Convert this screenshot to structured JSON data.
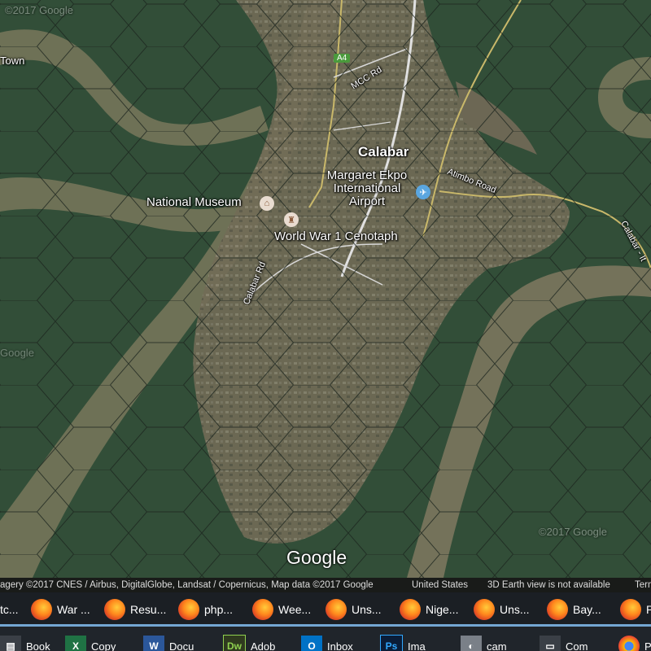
{
  "map": {
    "watermark_top": "©2017 Google",
    "watermark_bottom": "©2017 Google",
    "watermark_left": "Google",
    "labels": {
      "town": "Town",
      "city": "Calabar",
      "airport_line1": "Margaret Ekpo",
      "airport_line2": "International",
      "airport_line3": "Airport",
      "museum": "National Museum",
      "cenotaph": "World War 1 Cenotaph",
      "road_mcc": "MCC Rd",
      "road_a4": "A4",
      "road_atimbo": "Atimbo Road",
      "road_calabar": "Calabar Rd",
      "road_calabar_right": "Calabar - It"
    },
    "logo": "Google"
  },
  "attribution": {
    "imagery": "agery ©2017 CNES / Airbus, DigitalGlobe, Landsat / Copernicus, Map data ©2017 Google",
    "region": "United States",
    "earth": "3D Earth view is not available",
    "terms": "Terms"
  },
  "taskbar_tabs": [
    {
      "label": "tc..."
    },
    {
      "label": "War ..."
    },
    {
      "label": "Resu..."
    },
    {
      "label": "php..."
    },
    {
      "label": "Wee..."
    },
    {
      "label": "Uns..."
    },
    {
      "label": "Nige..."
    },
    {
      "label": "Uns..."
    },
    {
      "label": "Bay..."
    },
    {
      "label": "P"
    }
  ],
  "taskbar_apps": [
    {
      "label": "Book"
    },
    {
      "label": "Copy"
    },
    {
      "label": "Docu"
    },
    {
      "label": "Adob"
    },
    {
      "label": "Inbox"
    },
    {
      "label": "Ima"
    },
    {
      "label": "cam"
    },
    {
      "label": "Com"
    },
    {
      "label": "P"
    }
  ],
  "colors": {
    "forest": "#2f4a35",
    "river": "#7a7a5f",
    "urban": "#6f6a55",
    "taskbar": "#1b1f24",
    "taskbar_accent": "#74a7d3"
  }
}
